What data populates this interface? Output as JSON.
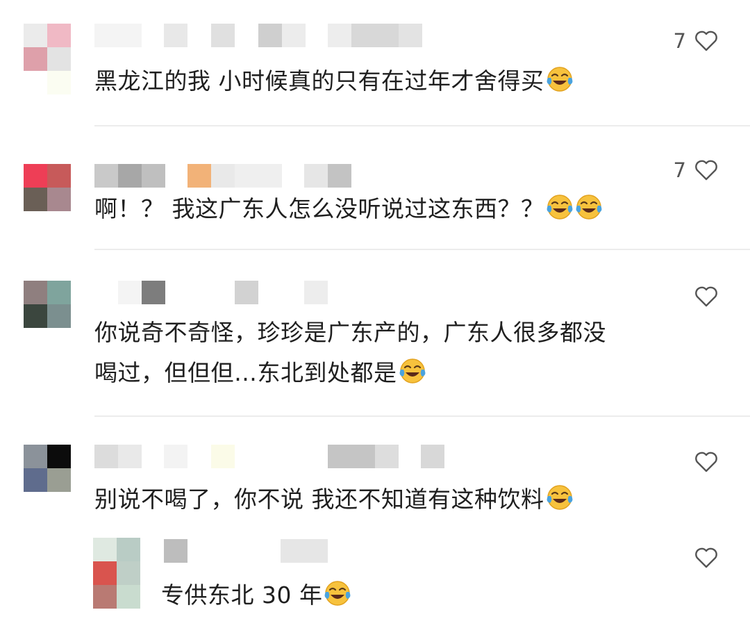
{
  "comments": [
    {
      "text": "黑龙江的我 小时候真的只有在过年才舍得买",
      "emoji_count": 1,
      "likes": "7",
      "avatar_colors": [
        "#ebebeb",
        "#f0b9c5",
        "#dea0aa",
        "#e3e3e3",
        "#ffffff",
        "#fbfdf2"
      ]
    },
    {
      "text": "啊！？ 我这广东人怎么没听说过这东西？？",
      "emoji_count": 2,
      "likes": "7",
      "avatar_colors": [
        "#ee3e56",
        "#c75a5a",
        "#6a5f56",
        "#a8888f"
      ]
    },
    {
      "text_lines": [
        "你说奇不奇怪，珍珍是广东产的，广东人很多都没",
        "喝过，但但但…东北到处都是"
      ],
      "emoji_count": 1,
      "likes": "",
      "avatar_colors": [
        "#8f7f7f",
        "#7fa49d",
        "#3b463e",
        "#7b8f8f"
      ]
    },
    {
      "text": "别说不喝了，你不说 我还不知道有这种饮料",
      "emoji_count": 1,
      "likes": "",
      "avatar_colors": [
        "#8b929a",
        "#0c0c0c",
        "#5f6c8d",
        "#9a9e93"
      ]
    },
    {
      "text": "专供东北 30 年",
      "emoji_count": 1,
      "likes": "",
      "avatar_colors": [
        "#dfe9e1",
        "#b9ccc5",
        "#d9544e",
        "#bfcfc7",
        "#b97a73",
        "#c9dccf"
      ]
    }
  ],
  "icons": {
    "like": "heart-outline-icon",
    "emoji": "laughing-crying-emoji-icon"
  },
  "colors": {
    "text": "#1f1f1f",
    "muted": "#555555",
    "divider": "#ececec",
    "emoji_face": "#f7c23d",
    "emoji_tear": "#4aa3df"
  }
}
